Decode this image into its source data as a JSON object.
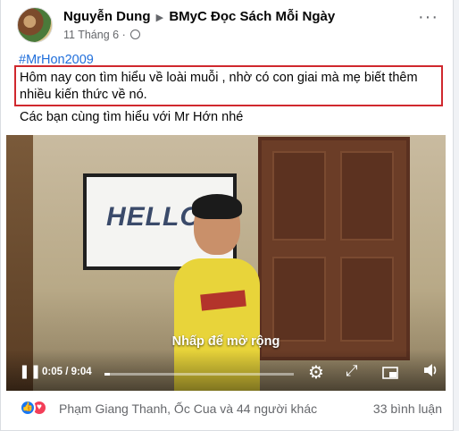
{
  "post": {
    "author": "Nguyễn Dung",
    "group": "BMyC Đọc Sách Mỗi Ngày",
    "date": "11 Tháng 6",
    "hashtag": "#MrHon2009",
    "text_line1": "Hôm nay con tìm hiểu về loài muỗi , nhờ có con giai mà mẹ biết thêm",
    "text_line2": "nhiều kiến thức về nó.",
    "text_line3": "Các bạn cùng tìm hiểu với Mr Hớn nhé"
  },
  "video": {
    "screen_text": "HELLO",
    "expand_hint": "Nhấp để mở rộng",
    "time": "0:05 / 9:04",
    "progress": 0.009
  },
  "footer": {
    "likers": "Phạm Giang Thanh, Ốc Cua và 44 người khác",
    "comments": "33 bình luận"
  },
  "icons": {
    "like": "like-icon",
    "love": "love-icon",
    "play_pause": "pause-icon",
    "settings": "gear-icon",
    "fullscreen": "expand-icon",
    "pip": "picture-in-picture-icon",
    "volume": "volume-icon"
  }
}
